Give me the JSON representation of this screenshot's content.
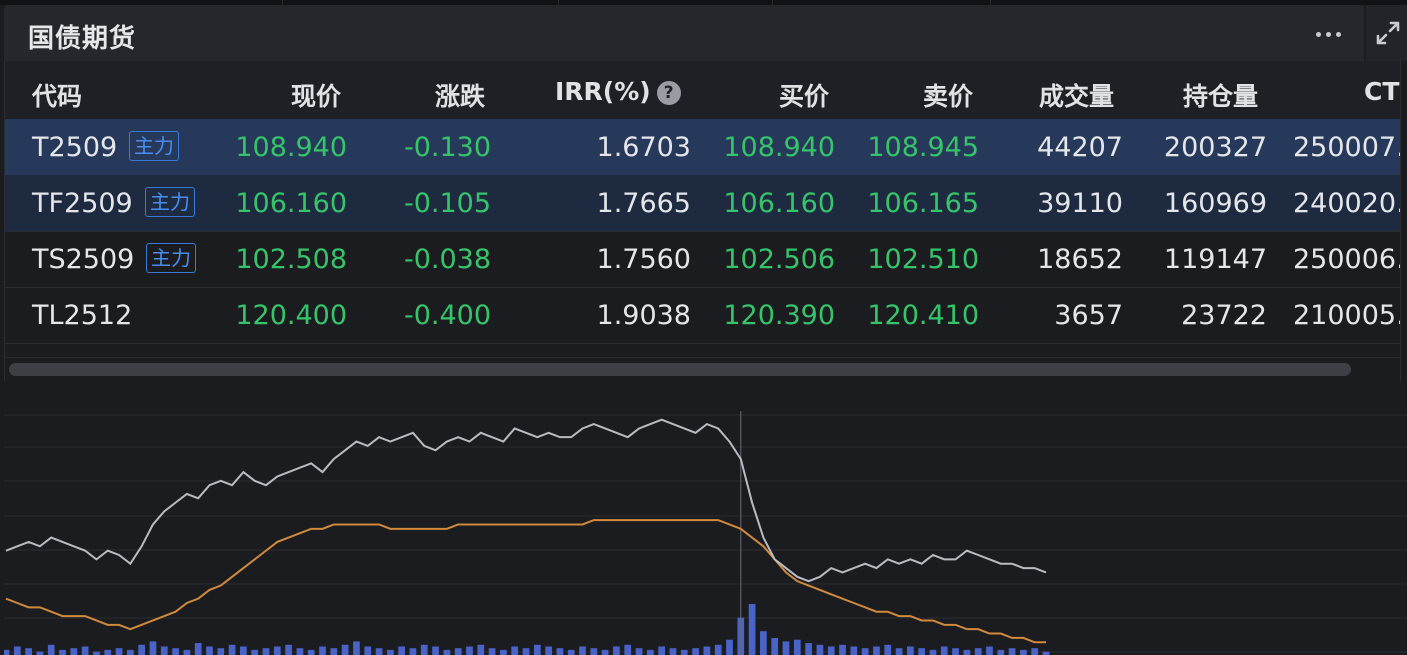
{
  "panel": {
    "title": "国债期货"
  },
  "table": {
    "columns": [
      "代码",
      "现价",
      "涨跌",
      "IRR(%)",
      "买价",
      "卖价",
      "成交量",
      "持仓量",
      "CT"
    ],
    "help_glyph": "?",
    "rows": [
      {
        "code": "T2509",
        "badge": "主力",
        "price": "108.940",
        "change": "-0.130",
        "irr": "1.6703",
        "bid": "108.940",
        "ask": "108.945",
        "volume": "44207",
        "oi": "200327",
        "ct": "250007."
      },
      {
        "code": "TF2509",
        "badge": "主力",
        "price": "106.160",
        "change": "-0.105",
        "irr": "1.7665",
        "bid": "106.160",
        "ask": "106.165",
        "volume": "39110",
        "oi": "160969",
        "ct": "240020."
      },
      {
        "code": "TS2509",
        "badge": "主力",
        "price": "102.508",
        "change": "-0.038",
        "irr": "1.7560",
        "bid": "102.506",
        "ask": "102.510",
        "volume": "18652",
        "oi": "119147",
        "ct": "250006."
      },
      {
        "code": "TL2512",
        "badge": "",
        "price": "120.400",
        "change": "-0.400",
        "irr": "1.9038",
        "bid": "120.390",
        "ask": "120.410",
        "volume": "3657",
        "oi": "23722",
        "ct": "210005."
      }
    ]
  },
  "colors": {
    "up_down_green": "#36c46a",
    "badge_blue": "#3a7bd9",
    "price_line": "#b9bcc3",
    "avg_line": "#d18a3c",
    "volume_bar": "#4a63c9",
    "selected_row": "#27395a"
  },
  "icons": {
    "more": "more-dots-icon",
    "expand": "expand-arrows-icon",
    "help": "help-circle-icon"
  },
  "chart_data": {
    "type": "line",
    "series": [
      {
        "values": [
          108.99,
          109.0,
          109.01,
          109.0,
          109.02,
          109.01,
          109.0,
          108.99,
          108.97,
          108.99,
          108.98,
          108.96,
          109.0,
          109.05,
          109.08,
          109.1,
          109.12,
          109.11,
          109.14,
          109.15,
          109.14,
          109.17,
          109.15,
          109.14,
          109.16,
          109.17,
          109.18,
          109.19,
          109.17,
          109.2,
          109.22,
          109.24,
          109.23,
          109.25,
          109.24,
          109.25,
          109.26,
          109.23,
          109.22,
          109.24,
          109.25,
          109.24,
          109.26,
          109.25,
          109.24,
          109.27,
          109.26,
          109.25,
          109.26,
          109.25,
          109.25,
          109.27,
          109.28,
          109.27,
          109.26,
          109.25,
          109.27,
          109.28,
          109.29,
          109.28,
          109.27,
          109.26,
          109.28,
          109.27,
          109.24,
          109.2,
          109.1,
          109.02,
          108.97,
          108.95,
          108.93,
          108.92,
          108.93,
          108.95,
          108.94,
          108.95,
          108.96,
          108.95,
          108.97,
          108.96,
          108.97,
          108.96,
          108.98,
          108.97,
          108.97,
          108.99,
          108.98,
          108.97,
          108.96,
          108.96,
          108.95,
          108.95,
          108.94
        ]
      },
      {
        "values": [
          108.88,
          108.87,
          108.86,
          108.86,
          108.85,
          108.84,
          108.84,
          108.84,
          108.83,
          108.82,
          108.82,
          108.81,
          108.82,
          108.83,
          108.84,
          108.85,
          108.87,
          108.88,
          108.9,
          108.91,
          108.93,
          108.95,
          108.97,
          108.99,
          109.01,
          109.02,
          109.03,
          109.04,
          109.04,
          109.05,
          109.05,
          109.05,
          109.05,
          109.05,
          109.04,
          109.04,
          109.04,
          109.04,
          109.04,
          109.04,
          109.05,
          109.05,
          109.05,
          109.05,
          109.05,
          109.05,
          109.05,
          109.05,
          109.05,
          109.05,
          109.05,
          109.05,
          109.06,
          109.06,
          109.06,
          109.06,
          109.06,
          109.06,
          109.06,
          109.06,
          109.06,
          109.06,
          109.06,
          109.06,
          109.05,
          109.04,
          109.02,
          109.0,
          108.97,
          108.94,
          108.92,
          108.91,
          108.9,
          108.89,
          108.88,
          108.87,
          108.86,
          108.85,
          108.85,
          108.84,
          108.84,
          108.83,
          108.83,
          108.82,
          108.82,
          108.81,
          108.81,
          108.8,
          108.8,
          108.79,
          108.79,
          108.78,
          108.78
        ]
      },
      {
        "type": "bar",
        "values": [
          3,
          5,
          4,
          2,
          6,
          3,
          4,
          5,
          2,
          3,
          4,
          3,
          6,
          8,
          5,
          4,
          3,
          7,
          5,
          4,
          6,
          5,
          3,
          4,
          5,
          6,
          4,
          3,
          5,
          4,
          6,
          8,
          5,
          4,
          3,
          5,
          4,
          6,
          5,
          3,
          4,
          5,
          6,
          4,
          3,
          5,
          4,
          6,
          5,
          4,
          3,
          5,
          4,
          3,
          5,
          6,
          4,
          3,
          5,
          4,
          3,
          4,
          5,
          6,
          9,
          22,
          30,
          14,
          10,
          8,
          9,
          7,
          6,
          5,
          6,
          5,
          4,
          5,
          6,
          4,
          5,
          4,
          3,
          5,
          4,
          3,
          4,
          5,
          3,
          4,
          3,
          4,
          2
        ]
      }
    ],
    "grid": true,
    "legend": "none"
  }
}
